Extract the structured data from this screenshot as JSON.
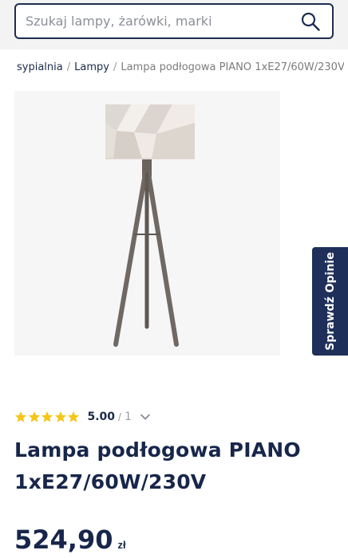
{
  "search": {
    "placeholder": "Szukaj lampy, żarówki, marki"
  },
  "breadcrumb": [
    {
      "label": "sypialnia"
    },
    {
      "label": "Lampy"
    },
    {
      "label": "Lampa podłogowa PIANO 1xE27/60W/230V"
    }
  ],
  "breadcrumb_separator": "/",
  "review_tab": {
    "label": "Sprawdź Opinie"
  },
  "rating": {
    "value": "5.00",
    "separator": "/",
    "count": "1",
    "stars": 5,
    "max_stars": 5
  },
  "product": {
    "title_line1": "Lampa podłogowa PIANO",
    "title_line2": "1xE27/60W/230V",
    "price": "524,90",
    "currency": "zł"
  },
  "colors": {
    "brand": "#1e2f5a",
    "star": "#f5c518",
    "image_bg": "#f6f6f6"
  }
}
